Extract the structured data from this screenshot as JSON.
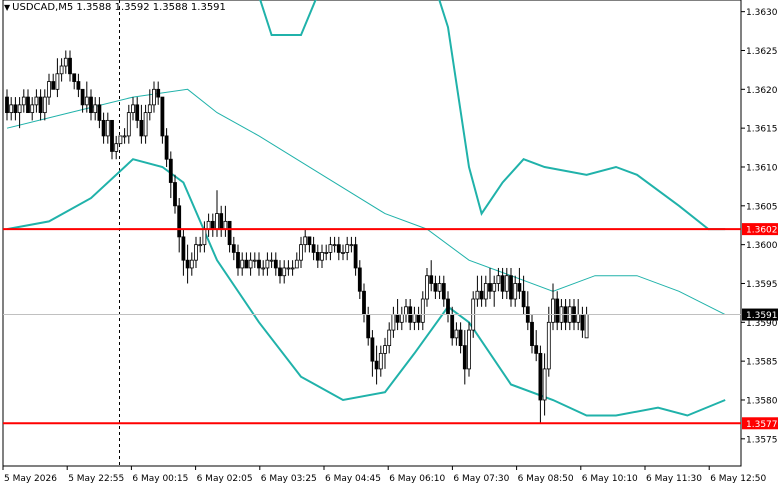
{
  "header": {
    "symbol": "USDCAD,M5",
    "ohlc": "1.3588 1.3592 1.3588 1.3591"
  },
  "colors": {
    "background": "#ffffff",
    "frame": "#000000",
    "candle": "#000000",
    "bollinger": "#20b2aa",
    "level": "#ff0000",
    "price_label_bg": "#000000",
    "price_label_text": "#ffffff"
  },
  "chart_data": {
    "type": "candlestick",
    "title": "USDCAD,M5",
    "ylim": [
      1.35715,
      1.36315
    ],
    "y_ticks": [
      "1.3575",
      "1.3580",
      "1.3585",
      "1.3590",
      "1.3595",
      "1.3600",
      "1.3605",
      "1.3610",
      "1.3615",
      "1.3620",
      "1.3625",
      "1.3630"
    ],
    "x_ticks": [
      "5 May 2026",
      "5 May 22:55",
      "6 May 00:15",
      "6 May 02:05",
      "6 May 03:25",
      "6 May 04:45",
      "6 May 06:10",
      "6 May 07:30",
      "6 May 08:50",
      "6 May 10:10",
      "6 May 11:30",
      "6 May 12:50"
    ],
    "horizontal_levels": [
      {
        "value": 1.3602,
        "label": "1.3602"
      },
      {
        "value": 1.3577,
        "label": "1.3577"
      }
    ],
    "current_price": {
      "value": 1.3591,
      "label": "1.3591"
    },
    "vertical_marker_time": "5 May 22:55",
    "bollinger": {
      "upper": [
        [
          0,
          1.3667
        ],
        [
          20,
          1.3667
        ],
        [
          40,
          1.3658
        ],
        [
          55,
          1.364
        ],
        [
          60,
          1.3632
        ],
        [
          63,
          1.3627
        ],
        [
          70,
          1.3627
        ],
        [
          80,
          1.364
        ],
        [
          95,
          1.3645
        ],
        [
          105,
          1.3628
        ],
        [
          110,
          1.361
        ],
        [
          113,
          1.3604
        ],
        [
          118,
          1.3608
        ],
        [
          123,
          1.3611
        ],
        [
          128,
          1.361
        ],
        [
          138,
          1.3609
        ],
        [
          145,
          1.361
        ],
        [
          150,
          1.3609
        ],
        [
          160,
          1.3605
        ],
        [
          167,
          1.3602
        ],
        [
          171,
          1.3602
        ]
      ],
      "middle": [
        [
          0,
          1.3615
        ],
        [
          15,
          1.3617
        ],
        [
          30,
          1.3619
        ],
        [
          43,
          1.362
        ],
        [
          50,
          1.3617
        ],
        [
          60,
          1.3614
        ],
        [
          75,
          1.3609
        ],
        [
          90,
          1.3604
        ],
        [
          100,
          1.3602
        ],
        [
          110,
          1.3598
        ],
        [
          120,
          1.3596
        ],
        [
          130,
          1.3594
        ],
        [
          140,
          1.3596
        ],
        [
          150,
          1.3596
        ],
        [
          160,
          1.3594
        ],
        [
          171,
          1.3591
        ]
      ],
      "lower": [
        [
          0,
          1.3602
        ],
        [
          10,
          1.3603
        ],
        [
          20,
          1.3606
        ],
        [
          30,
          1.3611
        ],
        [
          37,
          1.361
        ],
        [
          42,
          1.3608
        ],
        [
          50,
          1.3598
        ],
        [
          60,
          1.359
        ],
        [
          70,
          1.3583
        ],
        [
          80,
          1.358
        ],
        [
          90,
          1.3581
        ],
        [
          97,
          1.3586
        ],
        [
          105,
          1.3592
        ],
        [
          110,
          1.359
        ],
        [
          120,
          1.3582
        ],
        [
          130,
          1.358
        ],
        [
          138,
          1.3578
        ],
        [
          145,
          1.3578
        ],
        [
          155,
          1.3579
        ],
        [
          162,
          1.3578
        ],
        [
          171,
          1.358
        ]
      ]
    },
    "candles": [
      [
        1.3619,
        1.362,
        1.3616,
        1.3617
      ],
      [
        1.3617,
        1.3619,
        1.3616,
        1.3618
      ],
      [
        1.3618,
        1.3619,
        1.3616,
        1.3617
      ],
      [
        1.3617,
        1.3619,
        1.3615,
        1.3618
      ],
      [
        1.3618,
        1.362,
        1.3617,
        1.3619
      ],
      [
        1.3619,
        1.362,
        1.3617,
        1.3617
      ],
      [
        1.3617,
        1.3619,
        1.3616,
        1.3618
      ],
      [
        1.3618,
        1.362,
        1.3617,
        1.3619
      ],
      [
        1.3619,
        1.362,
        1.3616,
        1.3617
      ],
      [
        1.3617,
        1.362,
        1.3616,
        1.3619
      ],
      [
        1.3619,
        1.3622,
        1.3618,
        1.3621
      ],
      [
        1.3621,
        1.3622,
        1.362,
        1.362
      ],
      [
        1.362,
        1.3624,
        1.3619,
        1.3622
      ],
      [
        1.3622,
        1.3624,
        1.3621,
        1.3623
      ],
      [
        1.3623,
        1.3625,
        1.3622,
        1.3624
      ],
      [
        1.3624,
        1.3625,
        1.3621,
        1.3622
      ],
      [
        1.3622,
        1.3622,
        1.362,
        1.3621
      ],
      [
        1.3621,
        1.3622,
        1.3619,
        1.362
      ],
      [
        1.362,
        1.362,
        1.3617,
        1.3618
      ],
      [
        1.3618,
        1.3621,
        1.3617,
        1.3619
      ],
      [
        1.3619,
        1.362,
        1.3616,
        1.3617
      ],
      [
        1.3617,
        1.3619,
        1.3616,
        1.3618
      ],
      [
        1.3618,
        1.3619,
        1.3615,
        1.3616
      ],
      [
        1.3616,
        1.3617,
        1.3613,
        1.3614
      ],
      [
        1.3614,
        1.3617,
        1.3613,
        1.3616
      ],
      [
        1.3616,
        1.3616,
        1.3611,
        1.3612
      ],
      [
        1.3612,
        1.3614,
        1.3611,
        1.3613
      ],
      [
        1.3613,
        1.3614,
        1.3613,
        1.3614
      ],
      [
        1.3614,
        1.3615,
        1.3613,
        1.3614
      ],
      [
        1.3614,
        1.3618,
        1.3613,
        1.3617
      ],
      [
        1.3617,
        1.3619,
        1.3616,
        1.3618
      ],
      [
        1.3618,
        1.3619,
        1.3615,
        1.3616
      ],
      [
        1.3616,
        1.3618,
        1.3613,
        1.3614
      ],
      [
        1.3614,
        1.3618,
        1.3613,
        1.3617
      ],
      [
        1.3617,
        1.362,
        1.3616,
        1.3618
      ],
      [
        1.3618,
        1.3621,
        1.3617,
        1.362
      ],
      [
        1.362,
        1.3621,
        1.3618,
        1.3619
      ],
      [
        1.3619,
        1.3619,
        1.3613,
        1.3614
      ],
      [
        1.3614,
        1.3615,
        1.361,
        1.3611
      ],
      [
        1.3611,
        1.3612,
        1.3606,
        1.3608
      ],
      [
        1.3608,
        1.3609,
        1.3604,
        1.3605
      ],
      [
        1.3605,
        1.3606,
        1.3599,
        1.3601
      ],
      [
        1.3601,
        1.3602,
        1.3596,
        1.3598
      ],
      [
        1.3598,
        1.36,
        1.3595,
        1.3597
      ],
      [
        1.3597,
        1.3599,
        1.3596,
        1.3598
      ],
      [
        1.3598,
        1.3601,
        1.3597,
        1.36
      ],
      [
        1.36,
        1.3601,
        1.3599,
        1.36
      ],
      [
        1.36,
        1.3603,
        1.3599,
        1.3602
      ],
      [
        1.3602,
        1.3604,
        1.3601,
        1.3603
      ],
      [
        1.3603,
        1.3604,
        1.3601,
        1.3602
      ],
      [
        1.3602,
        1.3607,
        1.3601,
        1.3604
      ],
      [
        1.3604,
        1.3605,
        1.3601,
        1.3602
      ],
      [
        1.3602,
        1.3605,
        1.3601,
        1.3603
      ],
      [
        1.3603,
        1.3603,
        1.3599,
        1.36
      ],
      [
        1.36,
        1.3601,
        1.3598,
        1.3599
      ],
      [
        1.3599,
        1.36,
        1.3596,
        1.3597
      ],
      [
        1.3597,
        1.3599,
        1.3596,
        1.3598
      ],
      [
        1.3598,
        1.3599,
        1.3597,
        1.3597
      ],
      [
        1.3597,
        1.3599,
        1.3596,
        1.3598
      ],
      [
        1.3598,
        1.3599,
        1.3597,
        1.3598
      ],
      [
        1.3598,
        1.3599,
        1.3596,
        1.3597
      ],
      [
        1.3597,
        1.3598,
        1.3596,
        1.3597
      ],
      [
        1.3597,
        1.3599,
        1.3596,
        1.3598
      ],
      [
        1.3598,
        1.3599,
        1.3597,
        1.3598
      ],
      [
        1.3598,
        1.3599,
        1.3596,
        1.3597
      ],
      [
        1.3597,
        1.3598,
        1.3595,
        1.3596
      ],
      [
        1.3596,
        1.3598,
        1.3595,
        1.3597
      ],
      [
        1.3597,
        1.3598,
        1.3596,
        1.3597
      ],
      [
        1.3597,
        1.3598,
        1.3596,
        1.3597
      ],
      [
        1.3597,
        1.3599,
        1.3597,
        1.3598
      ],
      [
        1.3598,
        1.3601,
        1.3597,
        1.36
      ],
      [
        1.36,
        1.3602,
        1.3599,
        1.3601
      ],
      [
        1.3601,
        1.3601,
        1.3599,
        1.36
      ],
      [
        1.36,
        1.3601,
        1.3598,
        1.3599
      ],
      [
        1.3599,
        1.36,
        1.3597,
        1.3598
      ],
      [
        1.3598,
        1.36,
        1.3597,
        1.3599
      ],
      [
        1.3599,
        1.36,
        1.3598,
        1.3599
      ],
      [
        1.3599,
        1.3601,
        1.3598,
        1.36
      ],
      [
        1.36,
        1.3601,
        1.3599,
        1.36
      ],
      [
        1.36,
        1.3601,
        1.3598,
        1.3599
      ],
      [
        1.3599,
        1.36,
        1.3598,
        1.3599
      ],
      [
        1.3599,
        1.3601,
        1.3598,
        1.36
      ],
      [
        1.36,
        1.3601,
        1.3599,
        1.36
      ],
      [
        1.36,
        1.3601,
        1.3596,
        1.3597
      ],
      [
        1.3597,
        1.3598,
        1.3593,
        1.3594
      ],
      [
        1.3594,
        1.3595,
        1.359,
        1.3591
      ],
      [
        1.3591,
        1.3592,
        1.3587,
        1.3588
      ],
      [
        1.3588,
        1.3589,
        1.3583,
        1.3585
      ],
      [
        1.3585,
        1.3587,
        1.3582,
        1.3584
      ],
      [
        1.3584,
        1.3587,
        1.3583,
        1.3586
      ],
      [
        1.3586,
        1.3588,
        1.3584,
        1.3587
      ],
      [
        1.3587,
        1.359,
        1.3586,
        1.3589
      ],
      [
        1.3589,
        1.3592,
        1.3588,
        1.3591
      ],
      [
        1.3591,
        1.3593,
        1.3589,
        1.359
      ],
      [
        1.359,
        1.3592,
        1.3589,
        1.3591
      ],
      [
        1.3591,
        1.3593,
        1.359,
        1.3592
      ],
      [
        1.3592,
        1.3593,
        1.3589,
        1.359
      ],
      [
        1.359,
        1.3592,
        1.3589,
        1.3591
      ],
      [
        1.3591,
        1.3592,
        1.3589,
        1.359
      ],
      [
        1.359,
        1.3594,
        1.3589,
        1.3593
      ],
      [
        1.3593,
        1.3597,
        1.3592,
        1.3596
      ],
      [
        1.3596,
        1.3598,
        1.3594,
        1.3595
      ],
      [
        1.3595,
        1.3596,
        1.3593,
        1.3594
      ],
      [
        1.3594,
        1.3596,
        1.3593,
        1.3595
      ],
      [
        1.3595,
        1.3596,
        1.3592,
        1.3593
      ],
      [
        1.3593,
        1.3594,
        1.359,
        1.3591
      ],
      [
        1.3591,
        1.3592,
        1.3587,
        1.3588
      ],
      [
        1.3588,
        1.359,
        1.3587,
        1.3589
      ],
      [
        1.3589,
        1.359,
        1.3586,
        1.3587
      ],
      [
        1.3587,
        1.3589,
        1.3582,
        1.3584
      ],
      [
        1.3584,
        1.359,
        1.3583,
        1.3589
      ],
      [
        1.3589,
        1.3594,
        1.3588,
        1.3593
      ],
      [
        1.3593,
        1.3596,
        1.3592,
        1.3594
      ],
      [
        1.3594,
        1.3596,
        1.3592,
        1.3593
      ],
      [
        1.3593,
        1.3596,
        1.3592,
        1.3595
      ],
      [
        1.3595,
        1.3597,
        1.3593,
        1.3594
      ],
      [
        1.3594,
        1.3596,
        1.3592,
        1.3595
      ],
      [
        1.3595,
        1.3597,
        1.3594,
        1.3596
      ],
      [
        1.3596,
        1.3597,
        1.3593,
        1.3594
      ],
      [
        1.3594,
        1.3597,
        1.3593,
        1.3596
      ],
      [
        1.3596,
        1.3597,
        1.3592,
        1.3593
      ],
      [
        1.3593,
        1.3596,
        1.3592,
        1.3595
      ],
      [
        1.3595,
        1.3597,
        1.3593,
        1.3594
      ],
      [
        1.3594,
        1.3596,
        1.3591,
        1.3592
      ],
      [
        1.3592,
        1.3594,
        1.3589,
        1.359
      ],
      [
        1.359,
        1.3591,
        1.3586,
        1.3587
      ],
      [
        1.3587,
        1.3589,
        1.3585,
        1.3586
      ],
      [
        1.3586,
        1.3587,
        1.3577,
        1.358
      ],
      [
        1.358,
        1.3586,
        1.3578,
        1.3584
      ],
      [
        1.3584,
        1.3592,
        1.3583,
        1.359
      ],
      [
        1.359,
        1.3595,
        1.3589,
        1.3593
      ],
      [
        1.3593,
        1.3594,
        1.3589,
        1.359
      ],
      [
        1.359,
        1.3593,
        1.3589,
        1.3592
      ],
      [
        1.3592,
        1.3593,
        1.3589,
        1.359
      ],
      [
        1.359,
        1.3593,
        1.3589,
        1.3592
      ],
      [
        1.3592,
        1.3593,
        1.3589,
        1.359
      ],
      [
        1.359,
        1.3593,
        1.3589,
        1.3591
      ],
      [
        1.3591,
        1.3592,
        1.3588,
        1.3589
      ],
      [
        1.3588,
        1.3592,
        1.3588,
        1.3591
      ]
    ]
  }
}
